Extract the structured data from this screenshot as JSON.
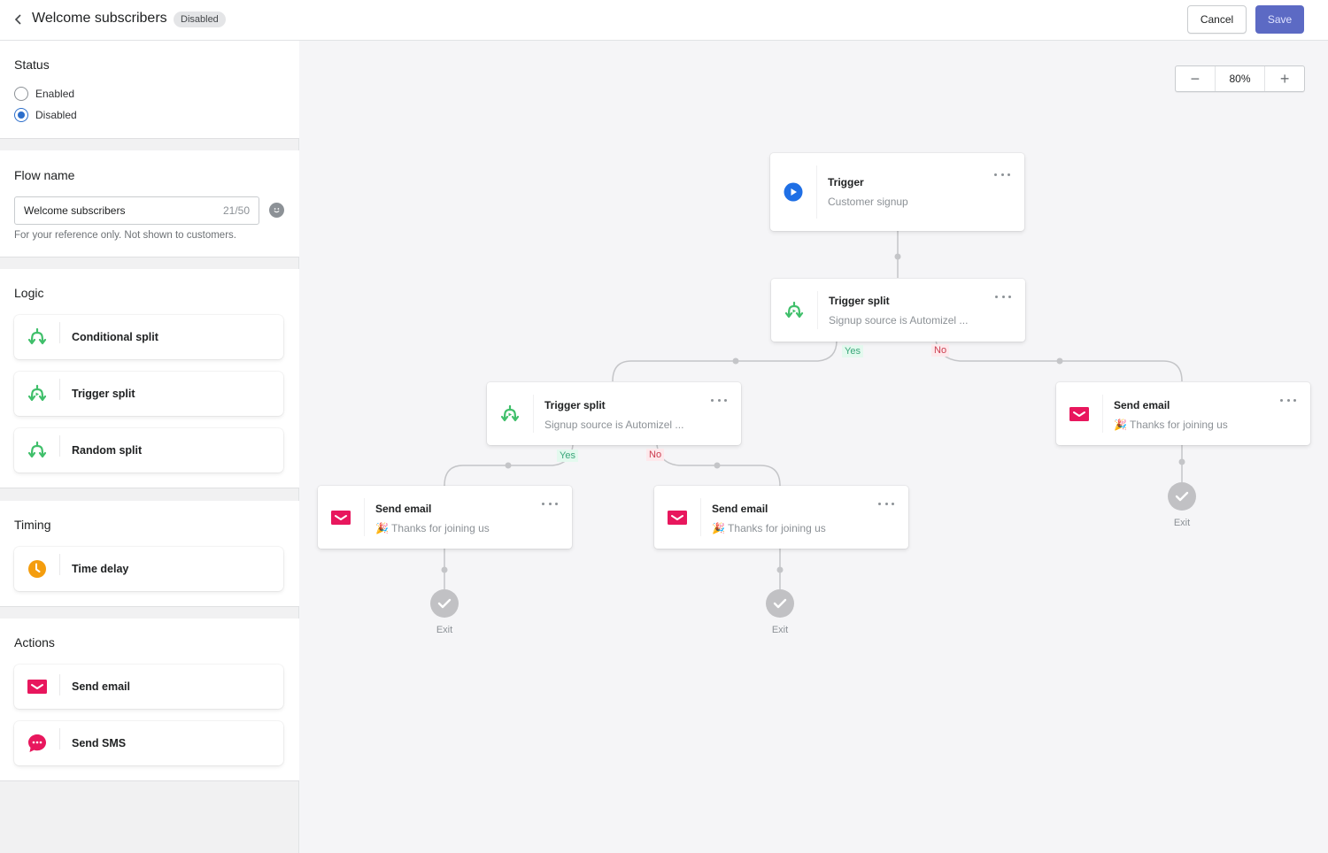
{
  "header": {
    "title": "Welcome subscribers",
    "status_badge": "Disabled",
    "cancel_label": "Cancel",
    "save_label": "Save"
  },
  "sidebar": {
    "status": {
      "title": "Status",
      "options": [
        {
          "label": "Enabled",
          "checked": false
        },
        {
          "label": "Disabled",
          "checked": true
        }
      ]
    },
    "flow_name": {
      "title": "Flow name",
      "value": "Welcome subscribers",
      "char_count": "21/50",
      "help_text": "For your reference only. Not shown to customers."
    },
    "logic": {
      "title": "Logic",
      "items": [
        {
          "label": "Conditional split",
          "icon": "split-icon"
        },
        {
          "label": "Trigger split",
          "icon": "trigger-split-icon"
        },
        {
          "label": "Random split",
          "icon": "split-icon"
        }
      ]
    },
    "timing": {
      "title": "Timing",
      "items": [
        {
          "label": "Time delay",
          "icon": "clock-icon"
        }
      ]
    },
    "actions": {
      "title": "Actions",
      "items": [
        {
          "label": "Send email",
          "icon": "email-icon"
        },
        {
          "label": "Send SMS",
          "icon": "sms-icon"
        }
      ]
    }
  },
  "canvas": {
    "zoom": {
      "minus": "−",
      "value": "80%",
      "plus": "+"
    },
    "nodes": {
      "trigger": {
        "title": "Trigger",
        "subtitle": "Customer signup"
      },
      "split1": {
        "title": "Trigger split",
        "subtitle": "Signup source is Automizel ..."
      },
      "split2": {
        "title": "Trigger split",
        "subtitle": "Signup source is Automizel ..."
      },
      "email_right": {
        "title": "Send email",
        "subtitle": "🎉 Thanks for joining us"
      },
      "email_left": {
        "title": "Send email",
        "subtitle": "🎉 Thanks for joining us"
      },
      "email_mid": {
        "title": "Send email",
        "subtitle": "🎉 Thanks for joining us"
      }
    },
    "branches": {
      "yes": "Yes",
      "no": "No"
    },
    "exit_label": "Exit"
  },
  "colors": {
    "primary": "#5c6ac4",
    "radio_checked": "#2c6ecb",
    "split_green": "#3fbf6a",
    "email_pink": "#e8175d",
    "clock_orange": "#f49d0e",
    "trigger_blue": "#1f6fe5"
  }
}
